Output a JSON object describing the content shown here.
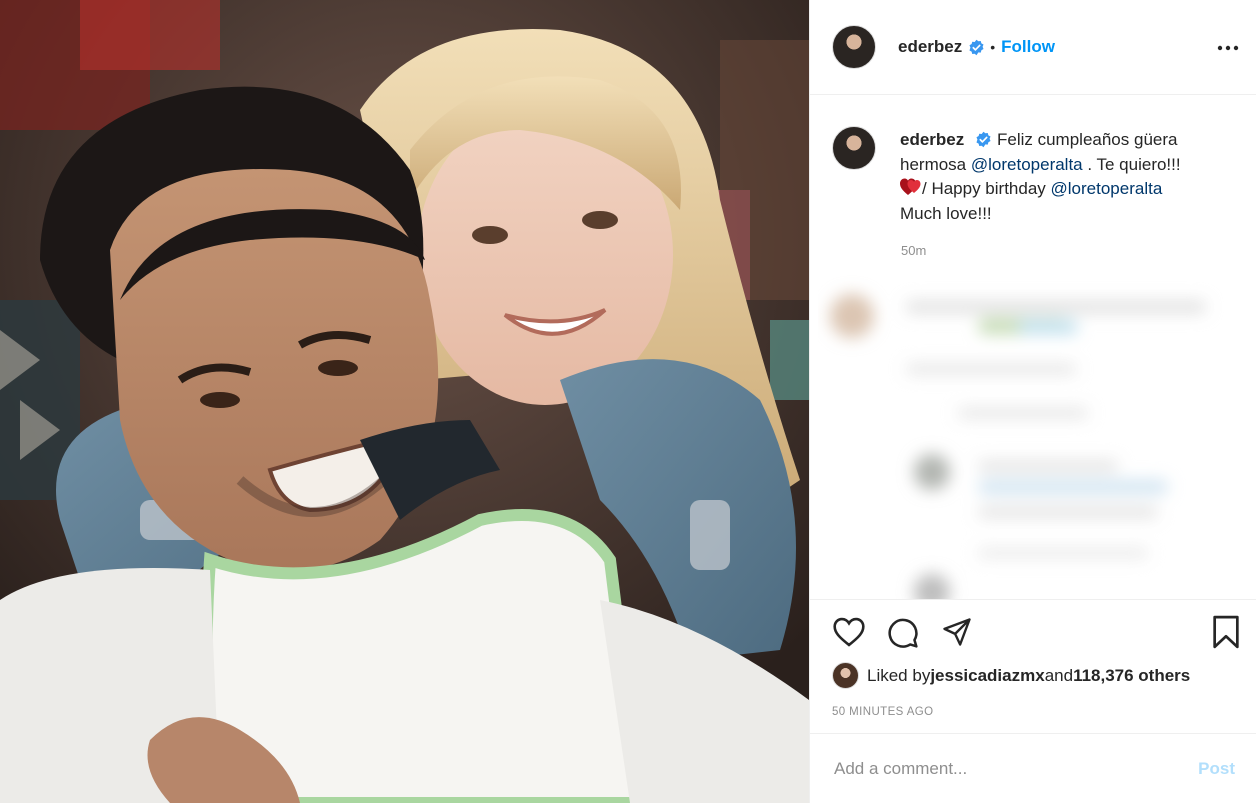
{
  "post": {
    "username": "ederbez",
    "follow_label": "Follow",
    "dot": "•",
    "caption": {
      "part1": "Feliz cumpleaños güera hermosa ",
      "mention1": "@loretoperalta",
      "part2": " . Te quiero!!!",
      "part3": "/ Happy birthday ",
      "mention2": "@loretoperalta",
      "part4": "Much love!!!"
    },
    "caption_time": "50m",
    "likes": {
      "prefix": "Liked by ",
      "user": "jessicadiazmx",
      "middle": " and ",
      "count": "118,376 others"
    },
    "posted_ago": "50 MINUTES AGO",
    "comment_placeholder": "Add a comment...",
    "post_button": "Post"
  },
  "icons": {
    "verified": "verified-badge-icon",
    "more": "more-options-icon",
    "heart_emoji": "red-hearts-emoji",
    "like": "heart-icon",
    "comment": "comment-icon",
    "share": "share-icon",
    "save": "bookmark-icon"
  },
  "colors": {
    "accent": "#0095f6",
    "mention": "#00376b",
    "muted": "#8e8e8e",
    "post_disabled": "#b2dffc",
    "border": "#efefef"
  }
}
